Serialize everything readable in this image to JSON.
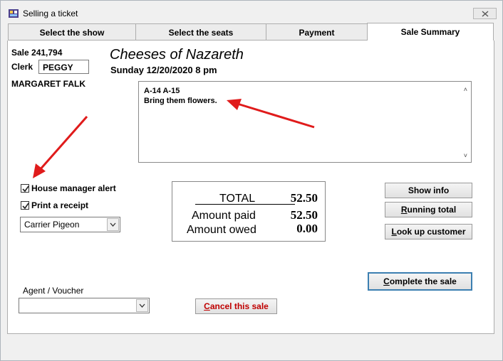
{
  "window": {
    "title": "Selling a ticket"
  },
  "tabs": [
    {
      "label": "Select the show"
    },
    {
      "label": "Select the seats"
    },
    {
      "label": "Payment"
    },
    {
      "label": "Sale Summary"
    }
  ],
  "sale": {
    "label": "Sale 241,794",
    "clerk_label": "Clerk",
    "clerk_value": "PEGGY",
    "customer": "MARGARET FALK"
  },
  "show": {
    "title": "Cheeses of Nazareth",
    "datetime": "Sunday 12/20/2020 8 pm"
  },
  "notes": {
    "text": "A-14 A-15\nBring them flowers."
  },
  "options": {
    "house_manager_alert": {
      "label": "House manager alert",
      "checked": true
    },
    "print_receipt": {
      "label": "Print a receipt",
      "checked": true
    },
    "delivery": {
      "value": "Carrier Pigeon"
    }
  },
  "totals": {
    "total_label": "TOTAL",
    "total_value": "52.50",
    "paid_label": "Amount paid",
    "paid_value": "52.50",
    "owed_label": "Amount owed",
    "owed_value": "0.00"
  },
  "buttons": {
    "show_info": "Show info",
    "running_total_u": "R",
    "running_total_rest": "unning total",
    "lookup_customer_u": "L",
    "lookup_customer_rest": "ook up customer",
    "complete_u": "C",
    "complete_rest": "omplete the sale",
    "cancel_u": "C",
    "cancel_rest": "ancel this sale"
  },
  "agent": {
    "label": "Agent / Voucher",
    "value": ""
  },
  "colors": {
    "annotation_arrow": "#e01b1b",
    "primary_border": "#3c7fb1",
    "cancel_text": "#c00000"
  }
}
